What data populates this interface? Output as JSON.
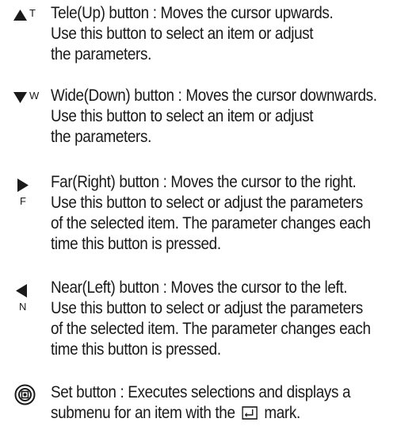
{
  "entries": [
    {
      "id": "tele-up",
      "icon": "triangle-up-icon",
      "icon_label": "T",
      "lines": [
        "Tele(Up) button : Moves the cursor upwards.",
        "Use this button to select an item or adjust",
        "the parameters."
      ]
    },
    {
      "id": "wide-down",
      "icon": "triangle-down-icon",
      "icon_label": "W",
      "lines": [
        "Wide(Down) button : Moves the cursor downwards.",
        "Use this button to select an item or adjust",
        "the parameters."
      ]
    },
    {
      "id": "far-right",
      "icon": "triangle-right-icon",
      "icon_label": "F",
      "lines": [
        "Far(Right) button : Moves the cursor to the right.",
        "Use this button to select or adjust the parameters",
        "of the selected item. The parameter changes each",
        "time this button is pressed."
      ]
    },
    {
      "id": "near-left",
      "icon": "triangle-left-icon",
      "icon_label": "N",
      "lines": [
        "Near(Left) button : Moves the cursor to the left.",
        "Use this button to select or adjust the parameters",
        "of the selected item. The parameter changes each",
        "time this button is pressed."
      ]
    },
    {
      "id": "set",
      "icon": "set-button-icon",
      "lines": [
        "Set button : Executes selections and displays a"
      ],
      "last_line_before": "submenu for an item with the",
      "last_line_mark_icon": "submenu-mark-icon",
      "last_line_after": "mark."
    }
  ]
}
